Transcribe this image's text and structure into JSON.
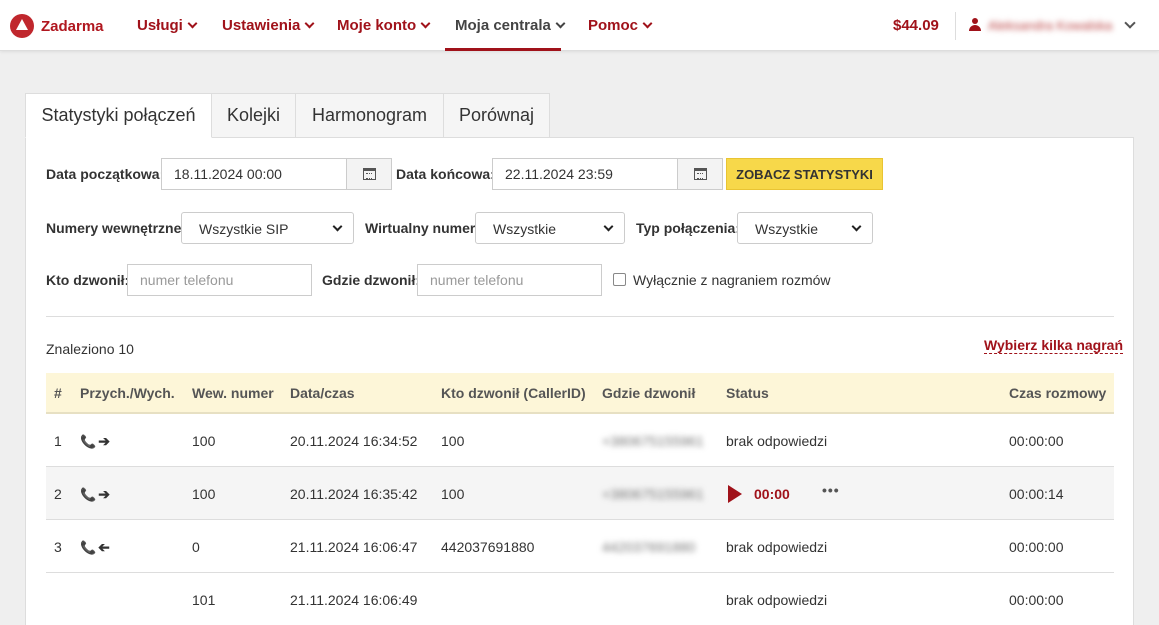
{
  "header": {
    "logo_text": "Zadarma",
    "nav": [
      {
        "label": "Usługi"
      },
      {
        "label": "Ustawienia"
      },
      {
        "label": "Moje konto"
      },
      {
        "label": "Moja centrala"
      },
      {
        "label": "Pomoc"
      }
    ],
    "active_nav": "Moja centrala",
    "balance": "$44.09",
    "user_name": "Aleksandra Kowalska"
  },
  "tabs": [
    {
      "label": "Statystyki połączeń"
    },
    {
      "label": "Kolejki"
    },
    {
      "label": "Harmonogram"
    },
    {
      "label": "Porównaj"
    }
  ],
  "filters": {
    "start_label": "Data początkowa:",
    "start_value": "18.11.2024 00:00",
    "end_label": "Data końcowa:",
    "end_value": "22.11.2024 23:59",
    "submit_label": "ZOBACZ STATYSTYKI",
    "internal_label": "Numery wewnętrzne:",
    "internal_value": "Wszystkie SIP",
    "virtual_label": "Wirtualny numer:",
    "virtual_value": "Wszystkie",
    "type_label": "Typ połączenia:",
    "type_value": "Wszystkie",
    "caller_label": "Kto dzwonił:",
    "caller_placeholder": "numer telefonu",
    "callee_label": "Gdzie dzwonił:",
    "callee_placeholder": "numer telefonu",
    "recording_only_label": "Wyłącznie z nagraniem rozmów"
  },
  "results": {
    "found_text": "Znaleziono 10",
    "pick_recordings": "Wybierz kilka nagrań"
  },
  "table": {
    "headers": [
      "#",
      "Przych./Wych.",
      "Wew. numer",
      "Data/czas",
      "Kto dzwonił (CallerID)",
      "Gdzie dzwonił",
      "Status",
      "Czas rozmowy"
    ],
    "rows": [
      {
        "num": "1",
        "direction": "out",
        "ext": "100",
        "datetime": "20.11.2024 16:34:52",
        "caller": "100",
        "callee": "+380675155961",
        "status": "brak odpowiedzi",
        "duration": "00:00:00"
      },
      {
        "num": "2",
        "direction": "out",
        "ext": "100",
        "datetime": "20.11.2024 16:35:42",
        "caller": "100",
        "callee": "+380675155961",
        "status": "",
        "recording_time": "00:00",
        "duration": "00:00:14"
      },
      {
        "num": "3",
        "direction": "in",
        "ext": "0",
        "datetime": "21.11.2024 16:06:47",
        "caller": "442037691880",
        "callee": "442037691880",
        "status": "brak odpowiedzi",
        "duration": "00:00:00"
      },
      {
        "num": "",
        "direction": "",
        "ext": "101",
        "datetime": "21.11.2024 16:06:49",
        "caller": "",
        "callee": "",
        "status": "brak odpowiedzi",
        "duration": "00:00:00"
      }
    ]
  },
  "colors": {
    "brand_red": "#a0121a",
    "accent_yellow": "#f7d84a",
    "table_header_bg": "#fdf6d8"
  }
}
